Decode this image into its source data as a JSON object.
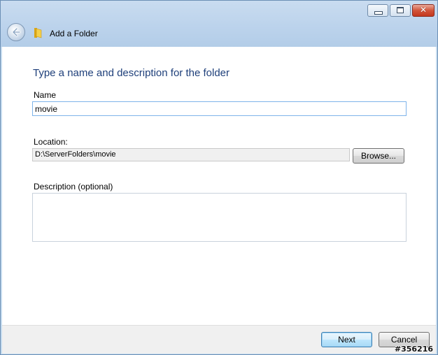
{
  "window": {
    "title": "Add a Folder",
    "caption_buttons": [
      "minimize",
      "maximize",
      "close"
    ],
    "close_glyph": "✕"
  },
  "page": {
    "heading": "Type a name and description for the folder",
    "name_label": "Name",
    "name_value": "movie",
    "location_label": "Location:",
    "location_value": "D:\\ServerFolders\\movie",
    "browse_label": "Browse...",
    "description_label": "Description (optional)",
    "description_value": ""
  },
  "footer": {
    "next_label": "Next",
    "cancel_label": "Cancel"
  },
  "watermark": "#356216",
  "icons": {
    "back": "back-arrow-icon",
    "folder": "folder-icon"
  },
  "colors": {
    "heading": "#1e3f7a",
    "titlebar": "#bcd3ec",
    "close_button": "#c4371c",
    "input_focus_border": "#7eb4ea"
  }
}
